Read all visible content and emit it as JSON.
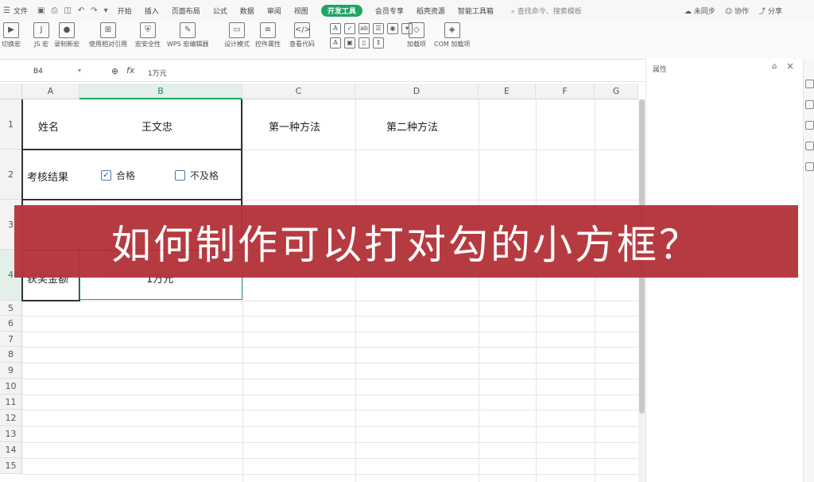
{
  "menubar": {
    "file": "文件",
    "tabs": [
      "开始",
      "插入",
      "页面布局",
      "公式",
      "数据",
      "审阅",
      "视图",
      "开发工具",
      "会员专享",
      "稻壳资源",
      "智能工具箱"
    ],
    "active_tab": "开发工具",
    "search_placeholder": "查找命令、搜索模板",
    "right": [
      "未同步",
      "协作",
      "分享"
    ]
  },
  "ribbon": {
    "buttons": [
      "切换宏",
      "JS 宏",
      "录制新宏",
      "使用相对引用",
      "宏安全性",
      "WPS 宏编辑器",
      "设计模式",
      "控件属性",
      "查看代码",
      "加载项",
      "COM 加载项"
    ]
  },
  "formula_bar": {
    "name_box": "B4",
    "value": "1万元"
  },
  "columns": [
    "A",
    "B",
    "C",
    "D",
    "E",
    "F",
    "G"
  ],
  "rows": [
    "1",
    "2",
    "3",
    "4",
    "5",
    "6",
    "7",
    "8",
    "9",
    "10",
    "11",
    "12",
    "13",
    "14",
    "15"
  ],
  "cells": {
    "a1": "姓名",
    "b1": "王文忠",
    "c1": "第一种方法",
    "d1": "第二种方法",
    "a2": "考核结果",
    "a4": "获奖金额",
    "b4": "1万元"
  },
  "checkboxes": [
    {
      "label": "合格",
      "checked": true
    },
    {
      "label": "不及格",
      "checked": false
    }
  ],
  "panel": {
    "title": "属性"
  },
  "banner": {
    "text": "如何制作可以打对勾的小方框？",
    "color": "#b4343a"
  },
  "accent_color": "#1fa463"
}
